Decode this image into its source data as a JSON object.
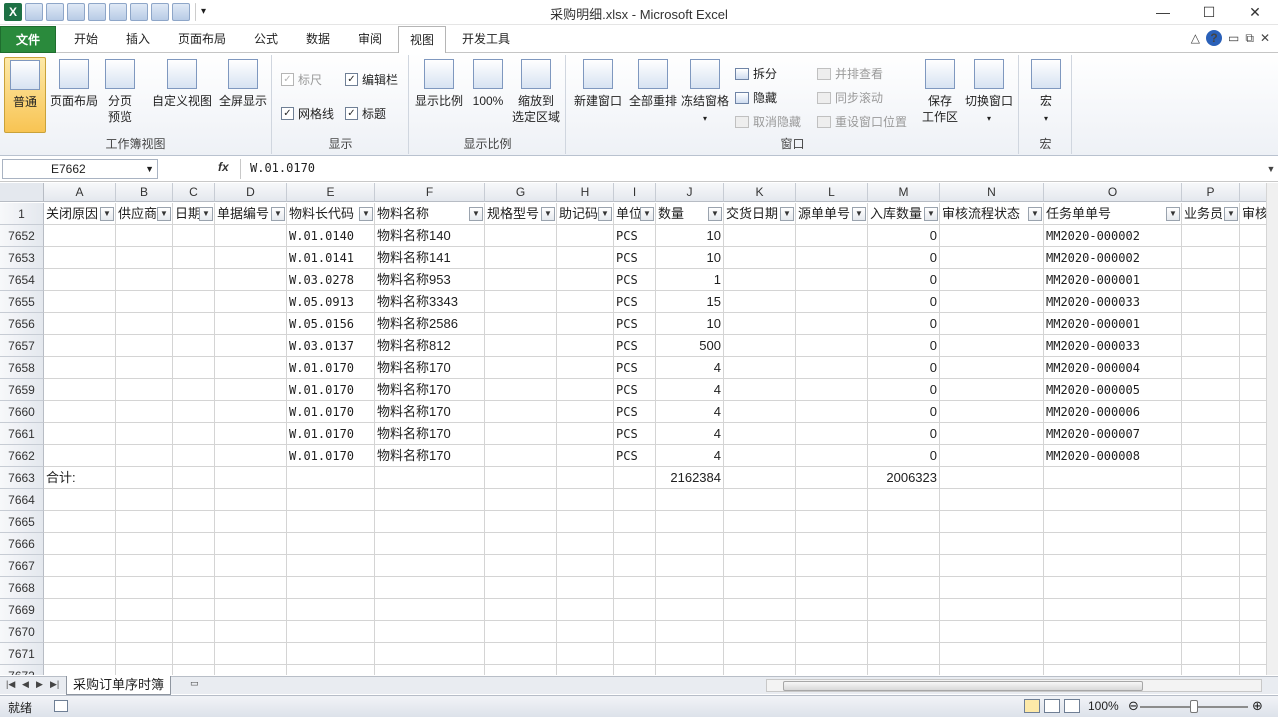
{
  "window": {
    "title": "采购明细.xlsx  -  Microsoft Excel"
  },
  "tabs": [
    "文件",
    "开始",
    "插入",
    "页面布局",
    "公式",
    "数据",
    "审阅",
    "视图",
    "开发工具"
  ],
  "active_tab": "视图",
  "ribbon": {
    "workbook_views": {
      "label": "工作簿视图",
      "normal": "普通",
      "page_layout": "页面布局",
      "page_break_1": "分页",
      "page_break_2": "预览",
      "custom": "自定义视图",
      "fullscreen": "全屏显示"
    },
    "show": {
      "label": "显示",
      "ruler": "标尺",
      "formula_bar": "编辑栏",
      "gridlines": "网格线",
      "headings": "标题"
    },
    "zoom": {
      "label": "显示比例",
      "zoom": "显示比例",
      "hundred": "100%",
      "sel_1": "缩放到",
      "sel_2": "选定区域"
    },
    "window": {
      "label": "窗口",
      "new_window": "新建窗口",
      "arrange_all": "全部重排",
      "freeze": "冻结窗格",
      "split": "拆分",
      "hide": "隐藏",
      "unhide": "取消隐藏",
      "side_by_side": "并排查看",
      "sync_scroll": "同步滚动",
      "reset_pos": "重设窗口位置",
      "save_ws_1": "保存",
      "save_ws_2": "工作区",
      "switch": "切换窗口"
    },
    "macro": {
      "label": "宏",
      "macro": "宏"
    }
  },
  "formula_bar": {
    "name_box": "E7662",
    "fx": "fx",
    "value": "W.01.0170"
  },
  "columns": [
    "A",
    "B",
    "C",
    "D",
    "E",
    "F",
    "G",
    "H",
    "I",
    "J",
    "K",
    "L",
    "M",
    "N",
    "O",
    "P"
  ],
  "header_row": {
    "num": "1",
    "cells": [
      "关闭原因",
      "供应商",
      "日期",
      "单据编号",
      "物料长代码",
      "物料名称",
      "规格型号",
      "助记码",
      "单位",
      "数量",
      "交货日期",
      "源单单号",
      "入库数量",
      "审核流程状态",
      "任务单单号",
      "业务员",
      "审核"
    ]
  },
  "rows": [
    {
      "num": "7652",
      "E": "W.01.0140",
      "F": "物料名称140",
      "I": "PCS",
      "J": "10",
      "M": "0",
      "O": "MM2020-000002"
    },
    {
      "num": "7653",
      "E": "W.01.0141",
      "F": "物料名称141",
      "I": "PCS",
      "J": "10",
      "M": "0",
      "O": "MM2020-000002"
    },
    {
      "num": "7654",
      "E": "W.03.0278",
      "F": "物料名称953",
      "I": "PCS",
      "J": "1",
      "M": "0",
      "O": "MM2020-000001"
    },
    {
      "num": "7655",
      "E": "W.05.0913",
      "F": "物料名称3343",
      "I": "PCS",
      "J": "15",
      "M": "0",
      "O": "MM2020-000033"
    },
    {
      "num": "7656",
      "E": "W.05.0156",
      "F": "物料名称2586",
      "I": "PCS",
      "J": "10",
      "M": "0",
      "O": "MM2020-000001"
    },
    {
      "num": "7657",
      "E": "W.03.0137",
      "F": "物料名称812",
      "I": "PCS",
      "J": "500",
      "M": "0",
      "O": "MM2020-000033"
    },
    {
      "num": "7658",
      "E": "W.01.0170",
      "F": "物料名称170",
      "I": "PCS",
      "J": "4",
      "M": "0",
      "O": "MM2020-000004"
    },
    {
      "num": "7659",
      "E": "W.01.0170",
      "F": "物料名称170",
      "I": "PCS",
      "J": "4",
      "M": "0",
      "O": "MM2020-000005"
    },
    {
      "num": "7660",
      "E": "W.01.0170",
      "F": "物料名称170",
      "I": "PCS",
      "J": "4",
      "M": "0",
      "O": "MM2020-000006"
    },
    {
      "num": "7661",
      "E": "W.01.0170",
      "F": "物料名称170",
      "I": "PCS",
      "J": "4",
      "M": "0",
      "O": "MM2020-000007"
    },
    {
      "num": "7662",
      "E": "W.01.0170",
      "F": "物料名称170",
      "I": "PCS",
      "J": "4",
      "M": "0",
      "O": "MM2020-000008"
    },
    {
      "num": "7663",
      "A": "合计:",
      "J": "2162384",
      "M": "2006323"
    },
    {
      "num": "7664"
    },
    {
      "num": "7665"
    },
    {
      "num": "7666"
    },
    {
      "num": "7667"
    },
    {
      "num": "7668"
    },
    {
      "num": "7669"
    },
    {
      "num": "7670"
    },
    {
      "num": "7671"
    },
    {
      "num": "7672"
    }
  ],
  "sheet": {
    "name": "采购订单序时簿"
  },
  "status": {
    "ready": "就绪",
    "zoom": "100%"
  }
}
